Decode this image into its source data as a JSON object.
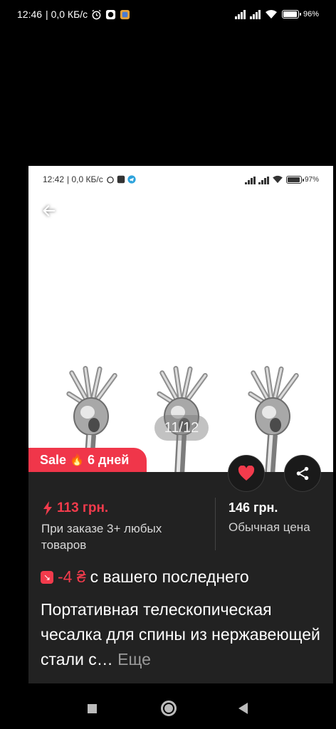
{
  "status_bar": {
    "time": "12:46",
    "net_speed": "| 0,0 КБ/с",
    "battery_pct": "96",
    "battery_suffix": "%",
    "battery_level": 0.96
  },
  "inner_status_bar": {
    "time": "12:42",
    "net_speed": "| 0,0 КБ/с",
    "battery_pct": "97",
    "battery_suffix": "%",
    "battery_level": 0.97
  },
  "gallery": {
    "counter": "11/12",
    "image": "telescopic-back-scratcher-skeleton-hand"
  },
  "sale_badge": {
    "label": "Sale",
    "days": "6 дней"
  },
  "price": {
    "promo_price": "113 грн.",
    "promo_condition": "При заказе 3+ любых товаров",
    "regular_price": "146 грн.",
    "regular_label": "Обычная цена"
  },
  "discount": {
    "value": "-4 ₴",
    "text": "с вашего последнего"
  },
  "product": {
    "title": "Портативная телескопическая чесалка для спины из нержавеющей стали с…",
    "more_label": "Еще"
  },
  "icons": {
    "back": "back-arrow-icon",
    "favorite": "heart-icon",
    "share": "share-icon"
  },
  "colors": {
    "accent": "#f0364a",
    "info_bg": "#222222",
    "page_bg": "#000000"
  }
}
